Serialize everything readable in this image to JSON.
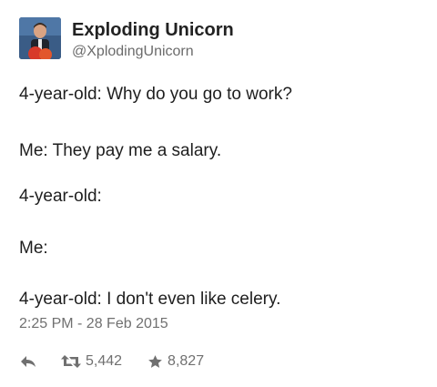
{
  "user": {
    "name": "Exploding Unicorn",
    "handle": "@XplodingUnicorn"
  },
  "tweet": {
    "lines": [
      "4-year-old: Why do you go to work?",
      "Me: They pay me a salary.",
      "4-year-old:",
      "Me:",
      "4-year-old: I don't even like celery."
    ],
    "timestamp": "2:25 PM - 28 Feb 2015"
  },
  "actions": {
    "reply_icon": "reply-arrow-icon",
    "retweet_icon": "retweet-icon",
    "retweet_count": "5,442",
    "favorite_icon": "star-icon",
    "favorite_count": "8,827"
  },
  "colors": {
    "text": "#1e1e1e",
    "meta": "#707070",
    "avatar_bg": "#2f4f7a",
    "avatar_accent": "#d83a2a"
  }
}
